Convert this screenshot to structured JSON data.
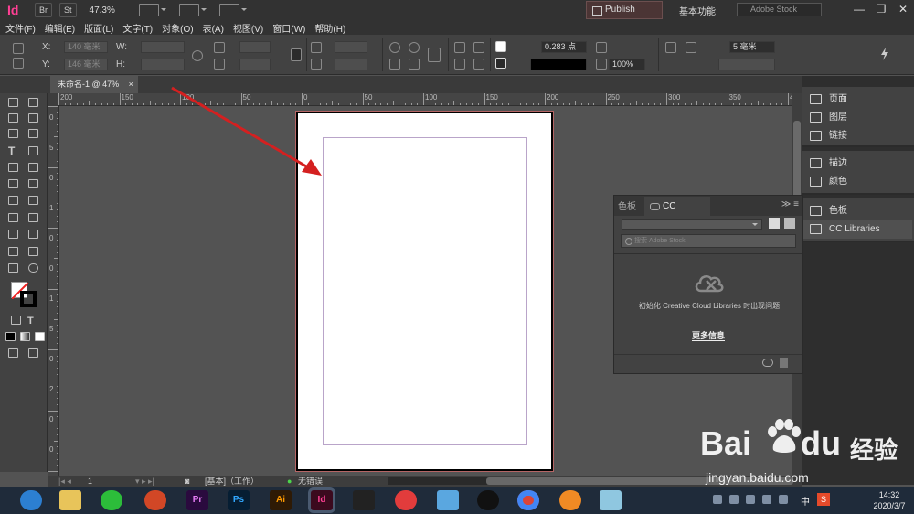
{
  "app": {
    "logo": "Id",
    "bridge": "Br",
    "stock_btn": "St",
    "zoom": "47.3%"
  },
  "topbar": {
    "publish": "Publish Online",
    "workspace": "基本功能",
    "stock_search_placeholder": "Adobe Stock",
    "minimize": "—",
    "restore": "❐",
    "close": "✕"
  },
  "menu": [
    "文件(F)",
    "编辑(E)",
    "版面(L)",
    "文字(T)",
    "对象(O)",
    "表(A)",
    "视图(V)",
    "窗口(W)",
    "帮助(H)"
  ],
  "control": {
    "x_label": "X:",
    "x_value": "140 毫米",
    "y_label": "Y:",
    "y_value": "146 毫米",
    "w_label": "W:",
    "h_label": "H:",
    "stroke_weight": "0.283 点",
    "opacity": "100%",
    "offset": "5 毫米"
  },
  "document": {
    "tab_title": "未命名-1 @ 47%",
    "tab_close": "×"
  },
  "ruler": {
    "h_labels": [
      "200",
      "150",
      "100",
      "50",
      "0",
      "50",
      "100",
      "150",
      "200",
      "250",
      "300",
      "350",
      "400"
    ],
    "v_labels": [
      "0",
      "5",
      "0",
      "1",
      "0",
      "0",
      "1",
      "5",
      "0",
      "2",
      "0",
      "0"
    ]
  },
  "dock": {
    "group1": [
      "页面",
      "图层",
      "链接"
    ],
    "group2": [
      "描边",
      "颜色"
    ],
    "group3": [
      "色板",
      "CC Libraries"
    ]
  },
  "cc_panel": {
    "tab_swatches": "色板",
    "tab_cc": "CC Libraries",
    "menu": "≫ ≡",
    "search_placeholder": "搜索 Adobe Stock",
    "message": "初始化 Creative Cloud Libraries 时出现问题",
    "more_info": "更多信息"
  },
  "status": {
    "page": "1",
    "layout": "[基本]（工作）",
    "errors": "无错误"
  },
  "taskbar": {
    "apps": [
      "Ps",
      "Pr",
      "Ai",
      "Id"
    ],
    "tray_ime": "中",
    "tray_s": "S",
    "time": "14:32",
    "date": "2020/3/7"
  },
  "watermark": {
    "brand": "Bai",
    "brand2": "du",
    "cn": "经验",
    "url": "jingyan.baidu.com"
  },
  "colors": {
    "accent_id": "#ff3f94",
    "arrow": "#d42020"
  }
}
